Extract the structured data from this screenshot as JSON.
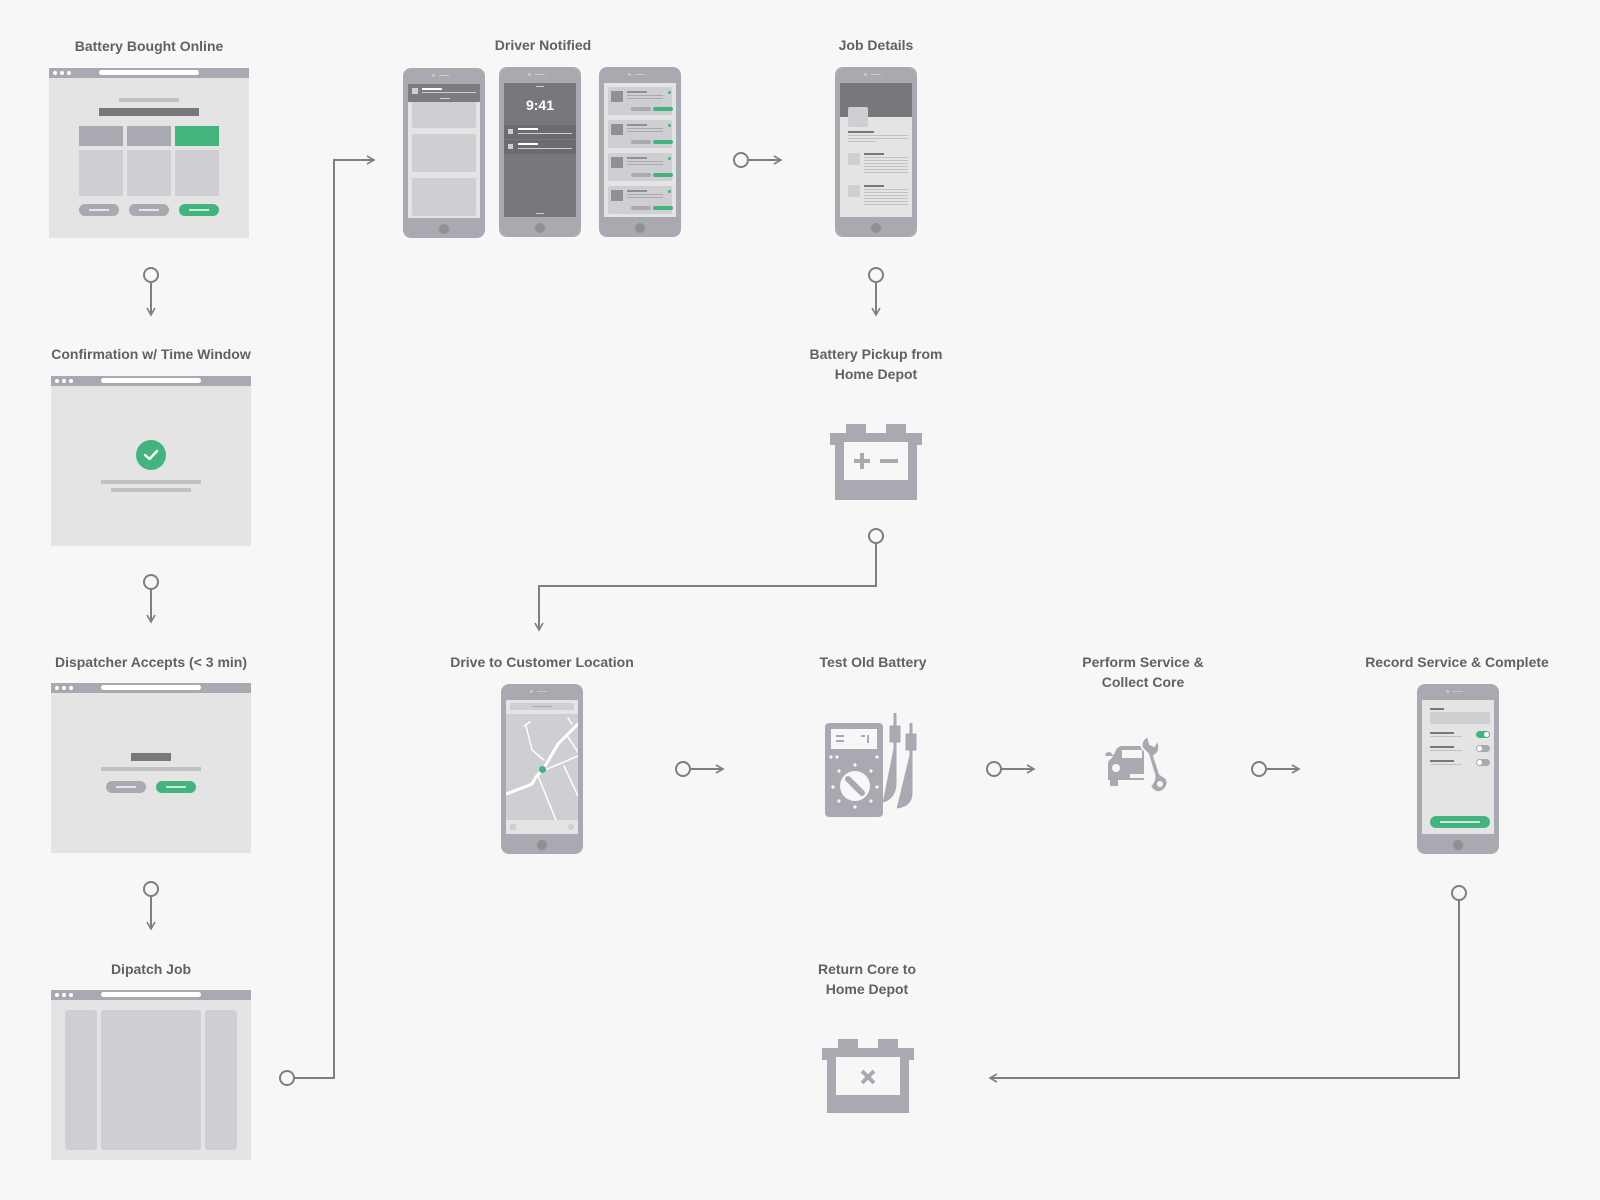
{
  "colors": {
    "background": "#f7f7f7",
    "wireframe_frame": "#a9a9b1",
    "wireframe_fill": "#e4e4e4",
    "accent_green": "#44b47e",
    "connector": "#7d7f84",
    "label_text": "#5f6166"
  },
  "steps": [
    {
      "id": "battery-bought-online",
      "label": "Battery Bought Online",
      "visual": "browser-product-grid"
    },
    {
      "id": "confirmation",
      "label": "Confirmation w/ Time Window",
      "visual": "browser-checkmark"
    },
    {
      "id": "dispatcher-accepts",
      "label": "Dispatcher Accepts (< 3 min)",
      "visual": "browser-accept-dialog"
    },
    {
      "id": "dispatch-job",
      "label": "Dipatch Job",
      "visual": "browser-three-columns"
    },
    {
      "id": "driver-notified",
      "label": "Driver Notified",
      "visual": "three-phones",
      "lock_time": "9:41"
    },
    {
      "id": "job-details",
      "label": "Job Details",
      "visual": "phone-detail"
    },
    {
      "id": "battery-pickup",
      "label_lines": [
        "Battery Pickup from",
        "Home Depot"
      ],
      "visual": "battery-icon"
    },
    {
      "id": "drive-to-customer",
      "label": "Drive to Customer Location",
      "visual": "phone-map"
    },
    {
      "id": "test-old-battery",
      "label": "Test Old Battery",
      "visual": "multimeter-icon"
    },
    {
      "id": "perform-service",
      "label_lines": [
        "Perform Service &",
        "Collect Core"
      ],
      "visual": "car-wrench-icon"
    },
    {
      "id": "record-service",
      "label": "Record Service & Complete",
      "visual": "phone-toggles",
      "toggles": [
        true,
        false,
        false
      ]
    },
    {
      "id": "return-core",
      "label_lines": [
        "Return Core to",
        "Home Depot"
      ],
      "visual": "battery-x-icon"
    }
  ],
  "flow": [
    [
      "battery-bought-online",
      "confirmation"
    ],
    [
      "confirmation",
      "dispatcher-accepts"
    ],
    [
      "dispatcher-accepts",
      "dispatch-job"
    ],
    [
      "dispatch-job",
      "driver-notified"
    ],
    [
      "driver-notified",
      "job-details"
    ],
    [
      "job-details",
      "battery-pickup"
    ],
    [
      "battery-pickup",
      "drive-to-customer"
    ],
    [
      "drive-to-customer",
      "test-old-battery"
    ],
    [
      "test-old-battery",
      "perform-service"
    ],
    [
      "perform-service",
      "record-service"
    ],
    [
      "record-service",
      "return-core"
    ]
  ]
}
